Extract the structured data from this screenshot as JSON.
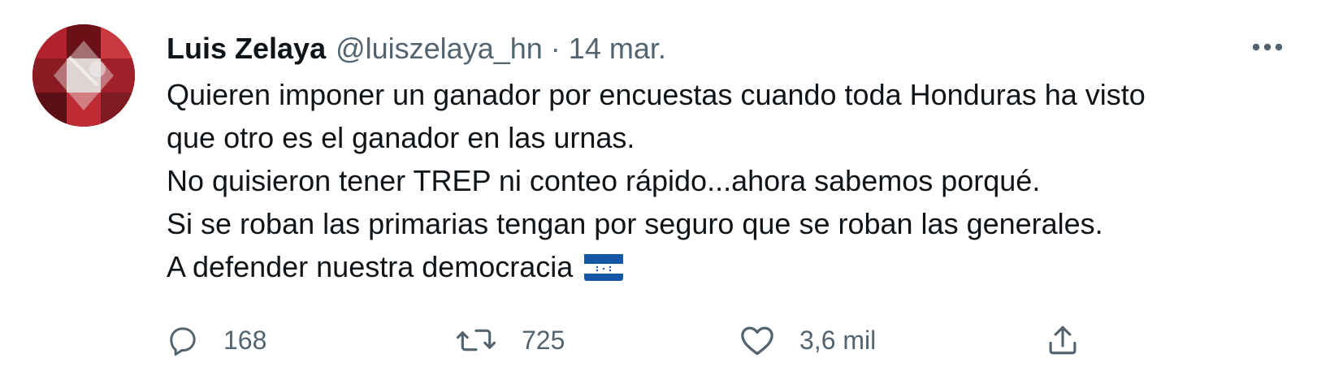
{
  "author": {
    "name": "Luis Zelaya",
    "handle": "@luiszelaya_hn",
    "separator": "·",
    "date": "14 mar."
  },
  "tweet": {
    "lines": [
      "Quieren imponer un ganador por encuestas cuando toda Honduras ha visto",
      "que otro es el ganador en las urnas.",
      "No quisieron tener TREP ni conteo rápido...ahora sabemos porqué.",
      "Si se roban las primarias tengan por seguro que se roban las generales.",
      "A defender nuestra democracia"
    ],
    "emoji": "honduras-flag-icon"
  },
  "actions": {
    "reply": {
      "icon": "reply-icon",
      "count": "168"
    },
    "retweet": {
      "icon": "retweet-icon",
      "count": "725"
    },
    "like": {
      "icon": "heart-icon",
      "count": "3,6 mil"
    },
    "share": {
      "icon": "share-icon"
    }
  },
  "colors": {
    "text": "#0f1419",
    "secondary": "#536471",
    "flag_blue": "#1457a7"
  }
}
